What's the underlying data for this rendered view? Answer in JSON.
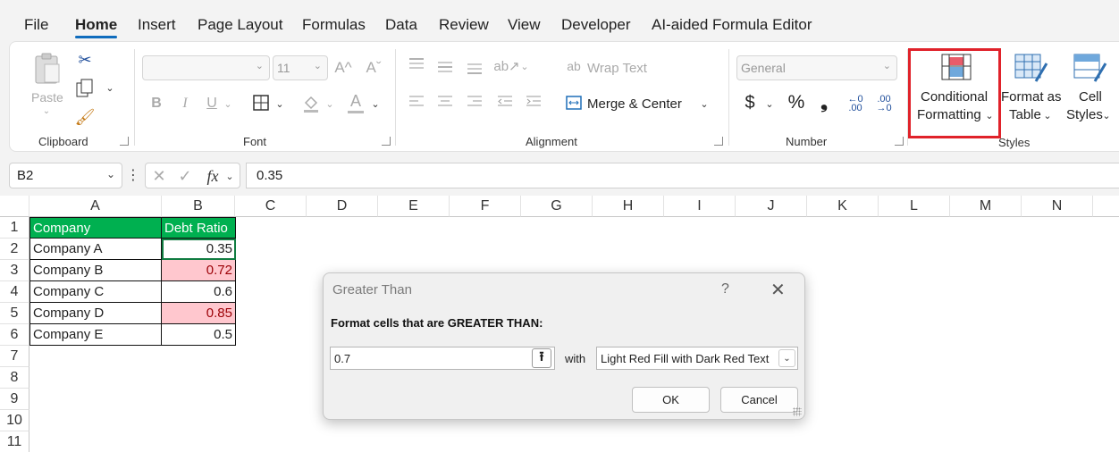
{
  "tabs": [
    "File",
    "Home",
    "Insert",
    "Page Layout",
    "Formulas",
    "Data",
    "Review",
    "View",
    "Developer",
    "AI-aided Formula Editor"
  ],
  "active_tab": "Home",
  "ribbon": {
    "clipboard": {
      "label": "Clipboard",
      "paste": "Paste"
    },
    "font": {
      "label": "Font",
      "font_size": "11",
      "bold": "B",
      "italic": "I",
      "underline": "U",
      "font_color": "A"
    },
    "alignment": {
      "label": "Alignment",
      "wrap_text": "Wrap Text",
      "merge_center": "Merge & Center"
    },
    "number": {
      "label": "Number",
      "format": "General",
      "currency": "$",
      "percent": "%",
      "comma": "❟",
      "inc_decimal": ".00",
      "dec_decimal": ".00"
    },
    "styles": {
      "label": "Styles",
      "conditional_formatting": [
        "Conditional",
        "Formatting"
      ],
      "format_as_table": [
        "Format as",
        "Table"
      ],
      "cell_styles": [
        "Cell",
        "Styles"
      ]
    }
  },
  "formula_bar": {
    "name_box": "B2",
    "fx": "fx",
    "value": "0.35"
  },
  "columns": [
    "A",
    "B",
    "C",
    "D",
    "E",
    "F",
    "G",
    "H",
    "I",
    "J",
    "K",
    "L",
    "M",
    "N"
  ],
  "rows": [
    "1",
    "2",
    "3",
    "4",
    "5",
    "6",
    "7",
    "8",
    "9",
    "10",
    "11"
  ],
  "table": {
    "headers": [
      "Company",
      "Debt Ratio"
    ],
    "rows": [
      [
        "Company A",
        "0.35"
      ],
      [
        "Company B",
        "0.72"
      ],
      [
        "Company C",
        "0.6"
      ],
      [
        "Company D",
        "0.85"
      ],
      [
        "Company E",
        "0.5"
      ]
    ]
  },
  "dialog": {
    "title": "Greater Than",
    "help": "?",
    "prompt": "Format cells that are GREATER THAN:",
    "value": "0.7",
    "with": "with",
    "format": "Light Red Fill with Dark Red Text",
    "ok": "OK",
    "cancel": "Cancel"
  },
  "colors": {
    "header_fill": "#00b050",
    "highlight_fill": "#ffc7ce",
    "highlight_text": "#9c0006",
    "accent": "#0f6cbd",
    "callout": "#e0222a"
  }
}
